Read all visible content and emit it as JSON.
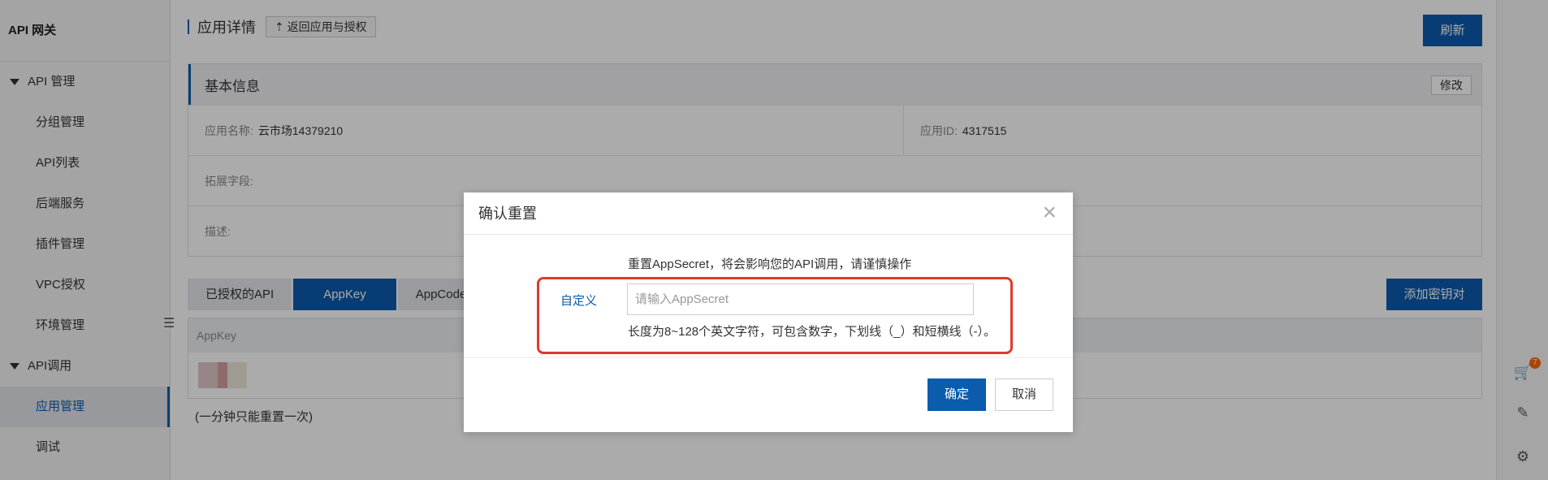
{
  "sidebar": {
    "brand": "API 网关",
    "groups": [
      {
        "label": "API 管理",
        "items": [
          "分组管理",
          "API列表",
          "后端服务",
          "插件管理",
          "VPC授权",
          "环境管理"
        ]
      },
      {
        "label": "API调用",
        "items": [
          "应用管理",
          "调试"
        ]
      }
    ],
    "active_item": "应用管理",
    "collapse_icon": "☰"
  },
  "header": {
    "title": "应用详情",
    "back_label": "返回应用与授权",
    "refresh_label": "刷新"
  },
  "basic_info": {
    "section_title": "基本信息",
    "edit_label": "修改",
    "app_name_label": "应用名称:",
    "app_name_value": "云市场14379210",
    "app_id_label": "应用ID:",
    "app_id_value": "4317515",
    "ext_label": "拓展字段:",
    "desc_label": "描述:"
  },
  "tabs": {
    "items": [
      "已授权的API",
      "AppKey",
      "AppCode"
    ],
    "active": "AppKey",
    "add_key_label": "添加密钥对"
  },
  "table": {
    "header": "AppKey",
    "note": "(一分钟只能重置一次)"
  },
  "rail": {
    "cart_badge": "7"
  },
  "modal": {
    "title": "确认重置",
    "warning": "重置AppSecret，将会影响您的API调用，请谨慎操作",
    "field_label": "自定义",
    "input_placeholder": "请输入AppSecret",
    "input_value": "",
    "hint": "长度为8~128个英文字符，可包含数字，下划线（_）和短横线（-）。",
    "ok_label": "确定",
    "cancel_label": "取消"
  },
  "colors": {
    "primary": "#0b5cad",
    "highlight_border": "#e03a2c",
    "badge": "#ff6600"
  }
}
